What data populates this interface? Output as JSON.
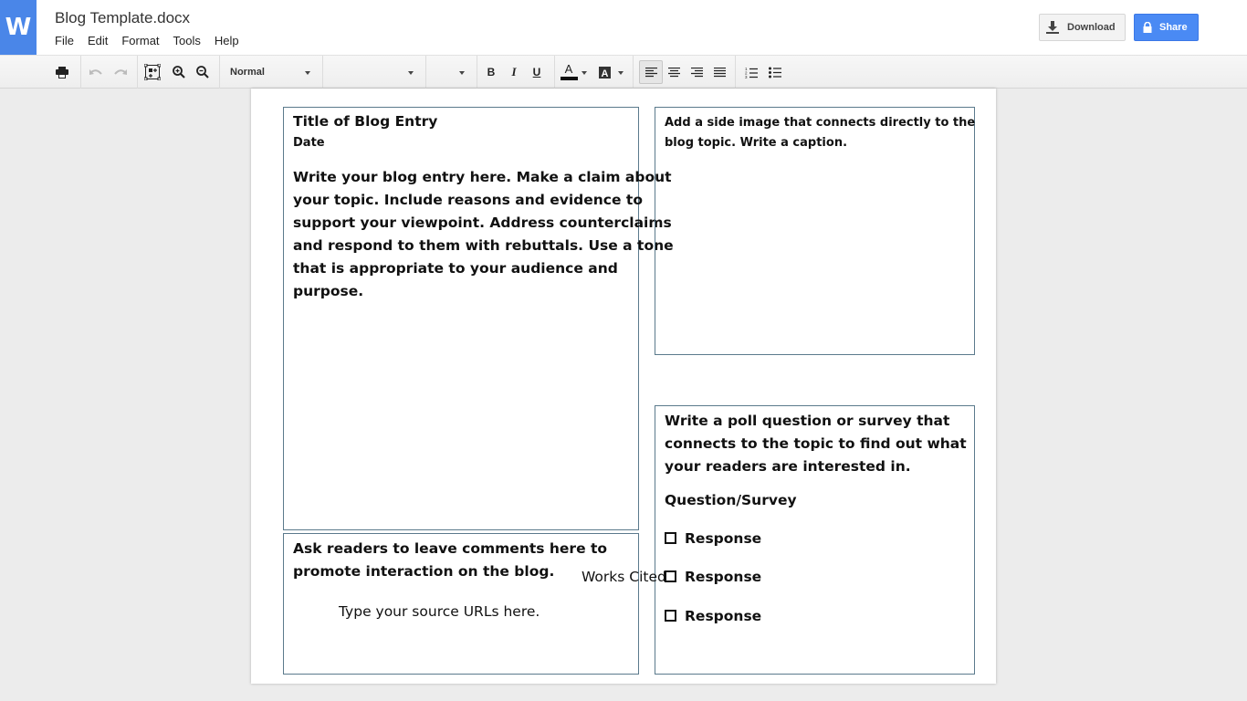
{
  "app": {
    "logo_letter": "W",
    "doc_title": "Blog Template.docx",
    "brand_color": "#4a86e8"
  },
  "menu": [
    "File",
    "Edit",
    "Format",
    "Tools",
    "Help"
  ],
  "actions": {
    "download_label": "Download",
    "share_label": "Share"
  },
  "toolbar": {
    "style_value": "Normal",
    "font_value": "",
    "size_value": "",
    "icons": [
      "print-icon",
      "undo-icon",
      "redo-icon",
      "fit-page-icon",
      "zoom-in-icon",
      "zoom-out-icon",
      "bold-icon",
      "italic-icon",
      "underline-icon",
      "text-color-icon",
      "highlight-color-icon",
      "align-left-icon",
      "align-center-icon",
      "align-right-icon",
      "justify-icon",
      "numbered-list-icon",
      "bulleted-list-icon"
    ],
    "active_alignment": "left"
  },
  "document": {
    "blog": {
      "title": "Title of Blog Entry",
      "date": "Date",
      "body_lines": [
        "Write your blog entry here. Make a claim about",
        "your topic. Include reasons and evidence to",
        "support your viewpoint. Address counterclaims",
        "and respond to them with rebuttals. Use a tone",
        "that is appropriate to your audience and",
        "purpose."
      ]
    },
    "image_box": {
      "lines": [
        "Add a side image that connects directly to the",
        "blog topic. Write a caption."
      ]
    },
    "poll": {
      "lines": [
        "Write a poll question or survey that",
        "connects to the topic to find out what",
        "your readers are interested in."
      ],
      "question": "Question/Survey",
      "responses": [
        "Response",
        "Response",
        "Response"
      ]
    },
    "comments": {
      "lines": [
        "Ask readers to leave comments here to",
        "promote interaction on the blog."
      ],
      "sources": "Type your source URLs here."
    },
    "works_cited": "Works Cited"
  }
}
